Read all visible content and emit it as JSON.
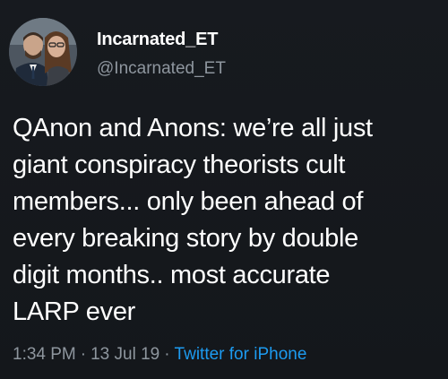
{
  "author": {
    "display_name": "Incarnated_ET",
    "handle": "@Incarnated_ET"
  },
  "tweet": {
    "lines": [
      "QAnon and Anons: we’re all just",
      "giant conspiracy theorists cult",
      "members... only been ahead of",
      "every breaking story by double",
      "digit months.. most accurate",
      "LARP ever"
    ]
  },
  "meta": {
    "time": "1:34 PM",
    "separator": "·",
    "date": "13 Jul 19",
    "source": "Twitter for iPhone"
  },
  "colors": {
    "background": "#15181c",
    "text": "#ffffff",
    "secondary_text": "#8e969e",
    "link": "#1d9bf0"
  }
}
